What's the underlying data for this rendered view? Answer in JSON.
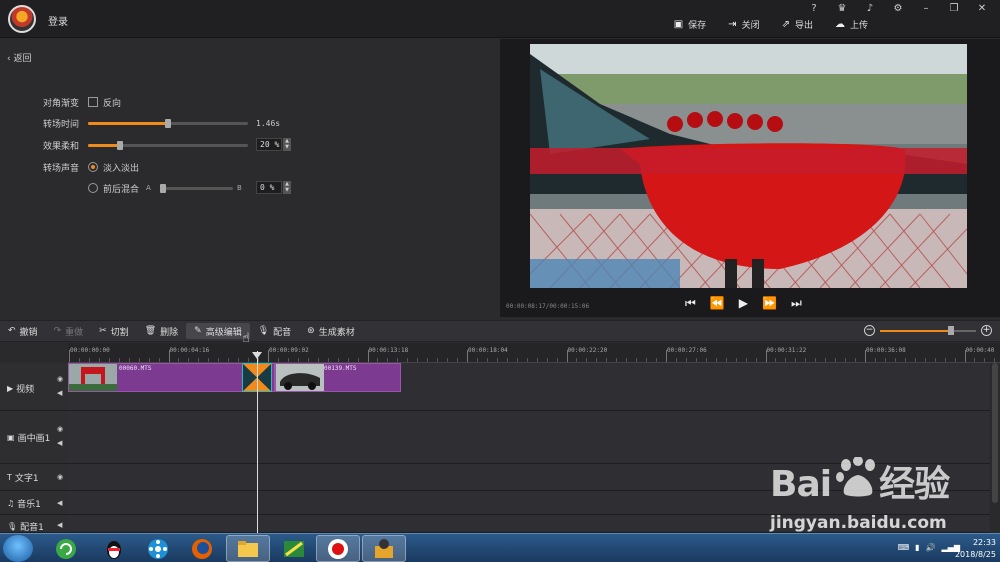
{
  "topbar": {
    "login": "登录",
    "actions": [
      {
        "label": "保存",
        "icon": "save-icon"
      },
      {
        "label": "关闭",
        "icon": "close-project-icon"
      },
      {
        "label": "导出",
        "icon": "export-icon"
      },
      {
        "label": "上传",
        "icon": "upload-icon"
      }
    ],
    "help": "?",
    "vip": "VIP"
  },
  "settings": {
    "back": "返回",
    "diagonal_label": "对角渐变",
    "reverse_label": "反向",
    "duration_label": "转场时间",
    "duration_value": "1.46s",
    "duration_level": 0.5,
    "softness_label": "效果柔和",
    "softness_value": "20 %",
    "softness_level": 0.2,
    "sound_label": "转场声音",
    "fade_label": "淡入淡出",
    "mix_label": "前后混合",
    "mix_a": "A",
    "mix_b": "B",
    "mix_value": "0 %"
  },
  "preview": {
    "time": "00:00:08:17/00:00:15:06"
  },
  "toolbar": {
    "undo": "撤销",
    "redo": "重做",
    "cut": "切割",
    "delete": "删除",
    "advanced": "高级编辑",
    "dub": "配音",
    "generate": "生成素材",
    "zoom_level": 0.74
  },
  "timeline": {
    "ticks": [
      "00:00:00:00",
      "00:00:04:16",
      "00:00:09:02",
      "00:00:13:18",
      "00:00:18:04",
      "00:00:22:20",
      "00:00:27:06",
      "00:00:31:22",
      "00:00:36:08",
      "00:00:40"
    ],
    "tracks": [
      {
        "name": "视频",
        "icon": "video-track-icon"
      },
      {
        "name": "画中画1",
        "icon": "pip-track-icon"
      },
      {
        "name": "文字1",
        "icon": "text-track-icon"
      },
      {
        "name": "音乐1",
        "icon": "music-track-icon"
      },
      {
        "name": "配音1",
        "icon": "mic-track-icon"
      }
    ],
    "clips": [
      {
        "name": "00060.MTS"
      },
      {
        "name": "00139.MTS"
      }
    ]
  },
  "watermark": {
    "logo_left": "Bai",
    "logo_right": "经验",
    "url": "jingyan.baidu.com"
  },
  "taskbar": {
    "time": "22:33",
    "date": "2018/8/25"
  }
}
